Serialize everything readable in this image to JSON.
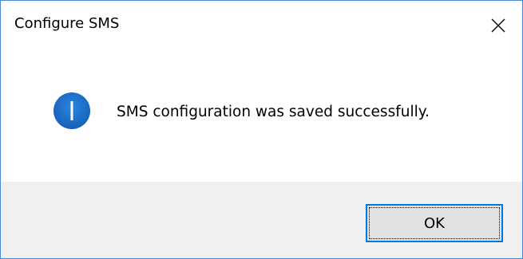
{
  "window": {
    "title": "Configure SMS",
    "close_icon": "close-icon"
  },
  "message": {
    "icon": "info-icon",
    "text": "SMS configuration was saved successfully."
  },
  "buttons": {
    "ok_label": "OK"
  },
  "colors": {
    "accent": "#0078d7",
    "border": "#4a8ad4",
    "footer_bg": "#f0f0f0",
    "button_bg": "#e1e1e1",
    "info_icon": "#1a6fc7"
  }
}
